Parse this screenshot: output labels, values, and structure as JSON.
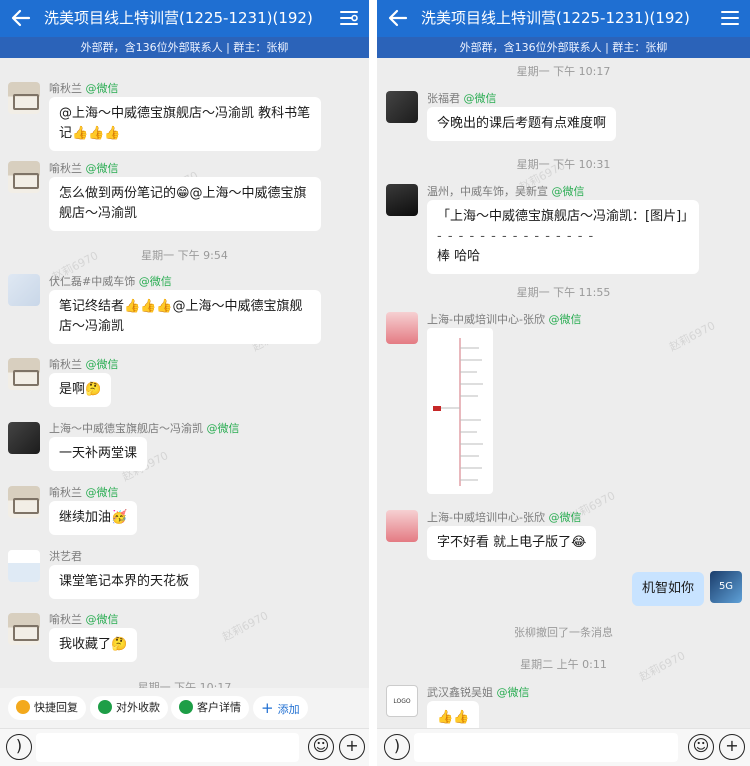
{
  "left": {
    "title": "洗美项目线上特训营(1225-1231)(192)",
    "subtitle": "外部群，含136位外部联系人 | 群主：张柳",
    "messages": [
      {
        "sender": "喻秋兰",
        "tag": "@微信",
        "text": "@上海～中威德宝旗舰店～冯渝凯 教科书笔记👍👍👍"
      },
      {
        "sender": "喻秋兰",
        "tag": "@微信",
        "text": "怎么做到两份笔记的😁@上海～中威德宝旗舰店～冯渝凯"
      },
      {
        "time": "星期一  下午 9:54"
      },
      {
        "sender": "伏仁磊#中威车饰",
        "tag": "@微信",
        "text": "笔记终结者👍👍👍@上海～中威德宝旗舰店～冯渝凯"
      },
      {
        "sender": "喻秋兰",
        "tag": "@微信",
        "text": "是啊🤔"
      },
      {
        "sender": "上海～中威德宝旗舰店～冯渝凯",
        "tag": "@微信",
        "text": "一天补两堂课"
      },
      {
        "sender": "喻秋兰",
        "tag": "@微信",
        "text": "继续加油🥳"
      },
      {
        "sender": "洪艺君",
        "tag": "",
        "text": "课堂笔记本界的天花板"
      },
      {
        "sender": "喻秋兰",
        "tag": "@微信",
        "text": "我收藏了🤔"
      },
      {
        "time": "星期一  下午 10:17"
      }
    ],
    "tools": [
      "快捷回复",
      "对外收款",
      "客户详情",
      "添加"
    ]
  },
  "right": {
    "title": "洗美项目线上特训营(1225-1231)(192)",
    "subtitle": "外部群，含136位外部联系人 | 群主：张柳",
    "messages": [
      {
        "time": "星期一  下午 10:17"
      },
      {
        "sender": "张福君",
        "tag": "@微信",
        "text": "今晚出的课后考题有点难度啊"
      },
      {
        "time": "星期一  下午 10:31"
      },
      {
        "sender": "温州，中威车饰，吴新宣",
        "tag": "@微信",
        "quote": "「上海～中威德宝旗舰店～冯渝凯：[图片]」",
        "dash": "- - - - - - - - - - - - - - -",
        "text": "棒 哈哈"
      },
      {
        "time": "星期一  下午 11:55"
      },
      {
        "sender": "上海-中威培训中心-张欣",
        "tag": "@微信",
        "image": "mindmap"
      },
      {
        "sender": "上海-中威培训中心-张欣",
        "tag": "@微信",
        "text": "字不好看 就上电子版了😂"
      },
      {
        "self": "机智如你"
      },
      {
        "notice": "张柳撤回了一条消息"
      },
      {
        "time": "星期二  上午 0:11"
      },
      {
        "sender": "武汉鑫锐吴姐",
        "tag": "@微信",
        "text": "👍👍"
      }
    ]
  },
  "watermark": "赵莉6970",
  "colors": {
    "header": "#1f6fd2",
    "subheader": "#2b63b9",
    "wechat_tag": "#2bad53",
    "self_bubble": "#c8e3ff"
  }
}
